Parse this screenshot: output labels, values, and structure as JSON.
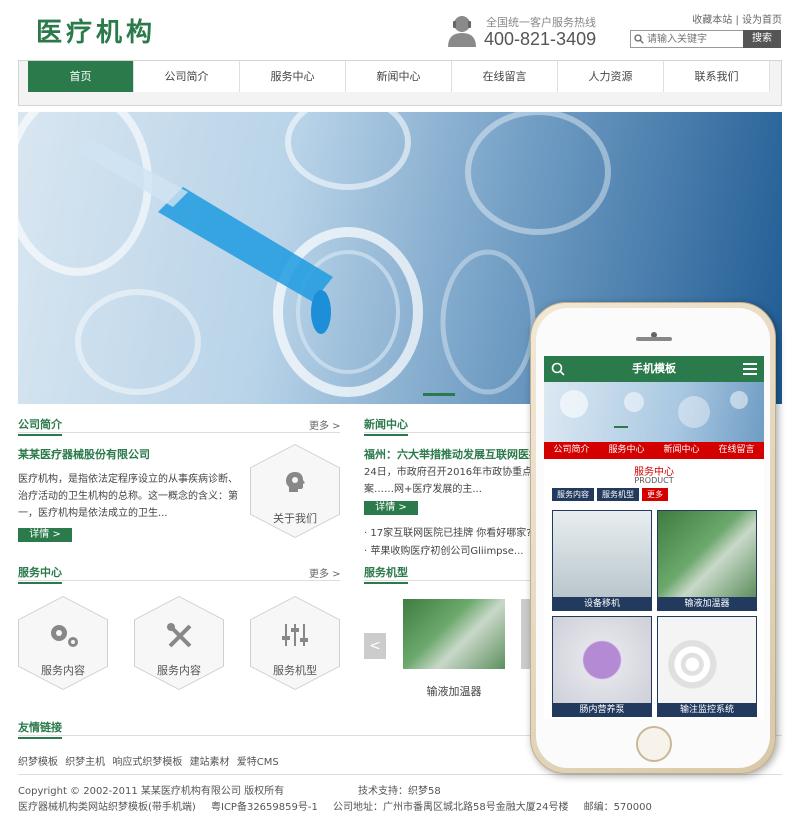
{
  "header": {
    "logo": "医疗机构",
    "hotline_label": "全国统一客户服务热线",
    "hotline_number": "400-821-3409",
    "links": [
      "收藏本站",
      "设为首页"
    ],
    "search_placeholder": "请输入关键字",
    "search_button": "搜索"
  },
  "nav": {
    "items": [
      "首页",
      "公司简介",
      "服务中心",
      "新闻中心",
      "在线留言",
      "人力资源",
      "联系我们"
    ],
    "active": "首页"
  },
  "about": {
    "title": "公司简介",
    "more": "更多 >",
    "company_name": "某某医疗器械股份有限公司",
    "description": "医疗机构，是指依法定程序设立的从事疾病诊断、治疗活动的卫生机构的总称。这一概念的含义：第一，医疗机构是依法成立的卫生...",
    "details_button": "详情 >",
    "hex_label": "关于我们"
  },
  "news": {
    "title": "新闻中心",
    "headline": "福州：六大举措推动发展互联网医疗",
    "summary": "24日，市政府召开2016年市政协重点提案……网+医疗发展的主...",
    "details_button": "详情 >",
    "items": [
      "17家互联网医院已挂牌 你看好哪家?",
      "苹果收购医疗初创公司Gliimpse..."
    ]
  },
  "services": {
    "title": "服务中心",
    "more": "更多 >",
    "items": [
      "服务内容",
      "服务内容",
      "服务机型"
    ]
  },
  "machines": {
    "title": "服务机型",
    "prev": "<",
    "item_label": "输液加温器"
  },
  "friend_links": {
    "title": "友情链接",
    "items": [
      "织梦模板",
      "织梦主机",
      "响应式织梦模板",
      "建站素材",
      "爱特CMS"
    ]
  },
  "footer": {
    "copyright": "Copyright © 2002-2011 某某医疗机构有限公司 版权所有",
    "tech": "技术支持：织梦58",
    "site_name": "医疗器械机构类网站织梦模板(带手机端)",
    "icp": "粤ICP备32659859号-1",
    "address": "公司地址：广州市番禺区城北路58号金融大厦24号楼",
    "postcode": "邮编：570000"
  },
  "mobile": {
    "title": "手机模板",
    "tabs": [
      "公司简介",
      "服务中心",
      "新闻中心",
      "在线留言"
    ],
    "section_cn": "服务中心",
    "section_en": "PRODUCT",
    "sub_tabs": [
      "服务内容",
      "服务机型",
      "更多"
    ],
    "cards": [
      "设备移机",
      "输液加温器",
      "肠内营养泵",
      "输注监控系统"
    ]
  },
  "colors": {
    "brand_green": "#2b7a4b",
    "mobile_red": "#d40000",
    "mobile_navy": "#223a5e"
  }
}
